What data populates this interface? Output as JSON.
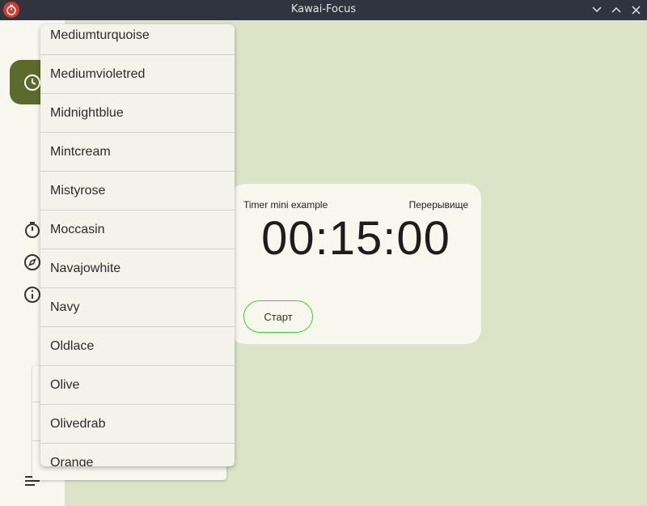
{
  "window": {
    "title": "Kawai-Focus"
  },
  "timer": {
    "name": "Timer mini example",
    "mode": "Перерывище",
    "time": "00:15:00",
    "start_label": "Старт"
  },
  "dropdown": {
    "items": [
      "Mediumturquoise",
      "Mediumvioletred",
      "Midnightblue",
      "Mintcream",
      "Mistyrose",
      "Moccasin",
      "Navajowhite",
      "Navy",
      "Oldlace",
      "Olive",
      "Olivedrab",
      "Orange"
    ]
  },
  "colors": {
    "accent": "#5b6b2d",
    "start_border": "#31d431",
    "app_icon": "#d7382c"
  }
}
